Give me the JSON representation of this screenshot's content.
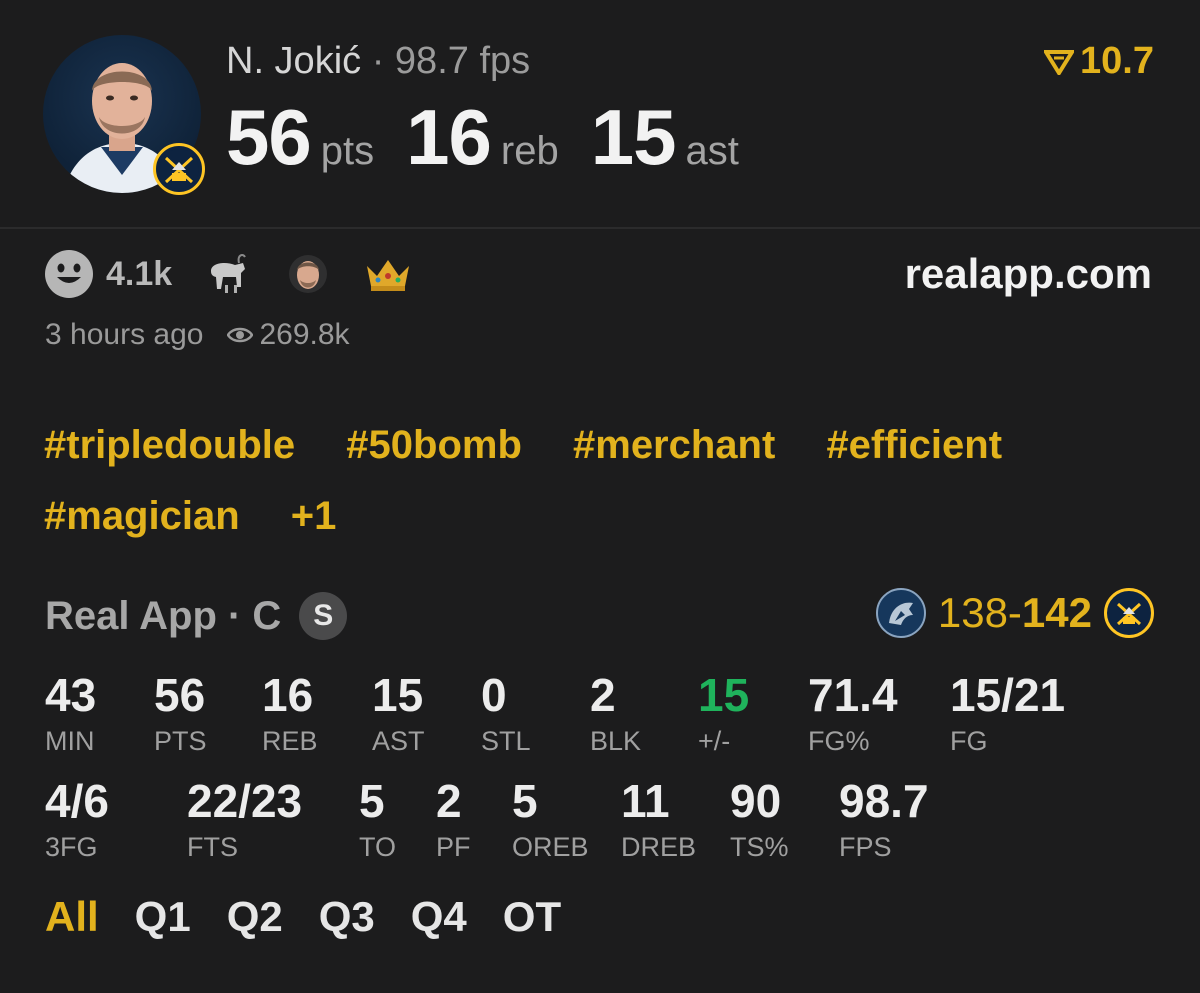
{
  "player": {
    "name": "N. Jokić",
    "separator": " · ",
    "fps_line": "98.7 fps",
    "headline": [
      {
        "value": "56",
        "unit": "pts"
      },
      {
        "value": "16",
        "unit": "reb"
      },
      {
        "value": "15",
        "unit": "ast"
      }
    ],
    "rating": "10.7"
  },
  "reactions": {
    "count": "4.1k",
    "emojis": [
      "smiley-icon",
      "goat-icon",
      "player-face-icon",
      "crown-icon"
    ],
    "site": "realapp.com",
    "time_ago": "3 hours ago",
    "views": "269.8k"
  },
  "hashtags": [
    "#tripledouble",
    "#50bomb",
    "#merchant",
    "#efficient",
    "#magician",
    "+1"
  ],
  "box": {
    "title": "Real App · C",
    "badge": "S",
    "score_away": "138-",
    "score_home": "142",
    "row1": [
      {
        "value": "43",
        "label": "MIN"
      },
      {
        "value": "56",
        "label": "PTS"
      },
      {
        "value": "16",
        "label": "REB"
      },
      {
        "value": "15",
        "label": "AST"
      },
      {
        "value": "0",
        "label": "STL"
      },
      {
        "value": "2",
        "label": "BLK"
      },
      {
        "value": "15",
        "label": "+/-"
      },
      {
        "value": "71.4",
        "label": "FG%"
      },
      {
        "value": "15/21",
        "label": "FG"
      }
    ],
    "row2": [
      {
        "value": "4/6",
        "label": "3FG"
      },
      {
        "value": "22/23",
        "label": "FTS"
      },
      {
        "value": "5",
        "label": "TO"
      },
      {
        "value": "2",
        "label": "PF"
      },
      {
        "value": "5",
        "label": "OREB"
      },
      {
        "value": "11",
        "label": "DREB"
      },
      {
        "value": "90",
        "label": "TS%"
      },
      {
        "value": "98.7",
        "label": "FPS"
      }
    ]
  },
  "tabs": [
    "All",
    "Q1",
    "Q2",
    "Q3",
    "Q4",
    "OT"
  ],
  "colors": {
    "accent": "#e2b21d",
    "positive": "#1fb35c",
    "background": "#1c1c1d"
  }
}
